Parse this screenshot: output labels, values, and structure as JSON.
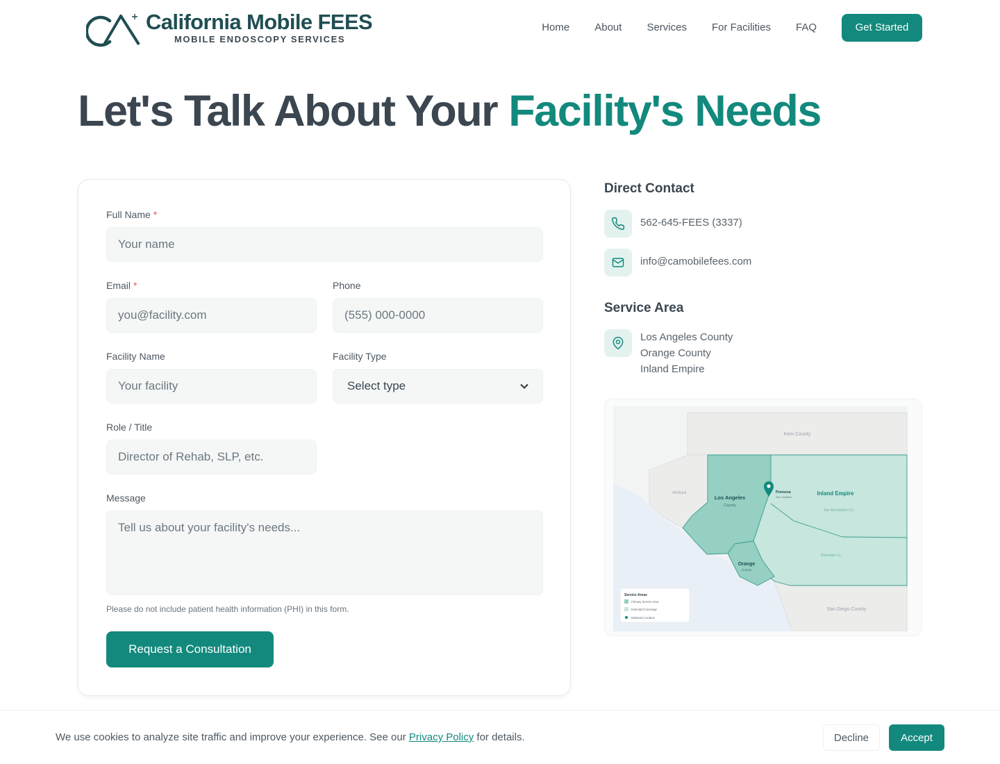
{
  "brand": {
    "title": "California Mobile FEES",
    "subtitle": "MOBILE ENDOSCOPY SERVICES",
    "accent_color": "#13897d"
  },
  "nav": {
    "items": [
      "Home",
      "About",
      "Services",
      "For Facilities",
      "FAQ"
    ],
    "cta": "Get Started"
  },
  "hero": {
    "title_main": "Let's Talk About Your ",
    "title_accent": "Facility's Needs"
  },
  "form": {
    "full_name": {
      "label": "Full Name",
      "required": "*",
      "placeholder": "Your name"
    },
    "email": {
      "label": "Email",
      "required": "*",
      "placeholder": "you@facility.com"
    },
    "phone": {
      "label": "Phone",
      "placeholder": "(555) 000-0000"
    },
    "facility_name": {
      "label": "Facility Name",
      "placeholder": "Your facility"
    },
    "facility_type": {
      "label": "Facility Type",
      "selected": "Select type"
    },
    "role": {
      "label": "Role / Title",
      "placeholder": "Director of Rehab, SLP, etc."
    },
    "message": {
      "label": "Message",
      "placeholder": "Tell us about your facility's needs..."
    },
    "note": "Please do not include patient health information (PHI) in this form.",
    "submit": "Request a Consultation"
  },
  "contact": {
    "heading": "Direct Contact",
    "phone": "562-645-FEES (3337)",
    "email": "info@camobilefees.com",
    "phone_icon": "phone-icon",
    "email_icon": "mail-icon"
  },
  "service_area": {
    "heading": "Service Area",
    "icon": "map-pin-icon",
    "areas": [
      "Los Angeles County",
      "Orange County",
      "Inland Empire"
    ]
  },
  "map": {
    "kern": "Kern County",
    "ventura": "Ventura",
    "la_1": "Los Angeles",
    "la_2": "County",
    "pomona": "Pomona",
    "pomona_sub": "Our Location",
    "inland": "Inland Empire",
    "sanbern": "San Bernardino Co.",
    "riverside": "Riverside Co.",
    "orange_1": "Orange",
    "orange_2": "County",
    "sandiego": "San Diego County",
    "legend_title": "Service Areas",
    "legend_primary": "Primary Service Area",
    "legend_extended": "Extended Coverage",
    "legend_business": "Business Location"
  },
  "cookie": {
    "text_before": "We use cookies to analyze site traffic and improve your experience. See our ",
    "link": "Privacy Policy",
    "text_after": " for details.",
    "decline": "Decline",
    "accept": "Accept"
  }
}
